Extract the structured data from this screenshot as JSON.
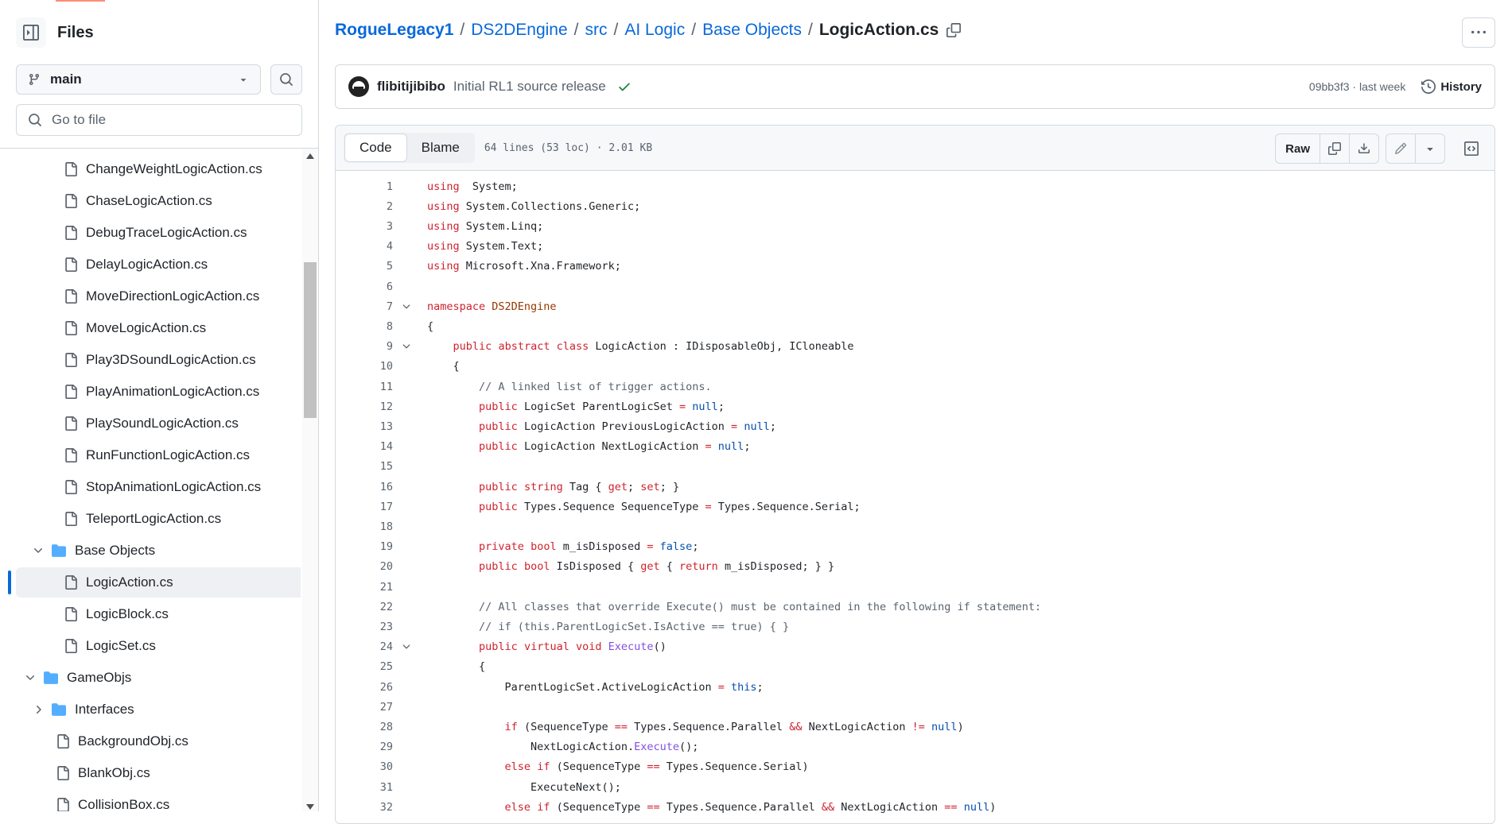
{
  "sidebar": {
    "title": "Files",
    "branch": "main",
    "goto_placeholder": "Go to file",
    "tree": [
      {
        "type": "file",
        "name": "ChangeWeightLogicAction.cs",
        "depth": 2
      },
      {
        "type": "file",
        "name": "ChaseLogicAction.cs",
        "depth": 2
      },
      {
        "type": "file",
        "name": "DebugTraceLogicAction.cs",
        "depth": 2
      },
      {
        "type": "file",
        "name": "DelayLogicAction.cs",
        "depth": 2
      },
      {
        "type": "file",
        "name": "MoveDirectionLogicAction.cs",
        "depth": 2
      },
      {
        "type": "file",
        "name": "MoveLogicAction.cs",
        "depth": 2
      },
      {
        "type": "file",
        "name": "Play3DSoundLogicAction.cs",
        "depth": 2
      },
      {
        "type": "file",
        "name": "PlayAnimationLogicAction.cs",
        "depth": 2
      },
      {
        "type": "file",
        "name": "PlaySoundLogicAction.cs",
        "depth": 2
      },
      {
        "type": "file",
        "name": "RunFunctionLogicAction.cs",
        "depth": 2
      },
      {
        "type": "file",
        "name": "StopAnimationLogicAction.cs",
        "depth": 2
      },
      {
        "type": "file",
        "name": "TeleportLogicAction.cs",
        "depth": 2
      },
      {
        "type": "folder",
        "name": "Base Objects",
        "depth": 1,
        "open": true
      },
      {
        "type": "file",
        "name": "LogicAction.cs",
        "depth": 2,
        "selected": true
      },
      {
        "type": "file",
        "name": "LogicBlock.cs",
        "depth": 2
      },
      {
        "type": "file",
        "name": "LogicSet.cs",
        "depth": 2
      },
      {
        "type": "folder",
        "name": "GameObjs",
        "depth": 0,
        "open": true
      },
      {
        "type": "folder",
        "name": "Interfaces",
        "depth": 1,
        "open": false
      },
      {
        "type": "file",
        "name": "BackgroundObj.cs",
        "depth": 1
      },
      {
        "type": "file",
        "name": "BlankObj.cs",
        "depth": 1
      },
      {
        "type": "file",
        "name": "CollisionBox.cs",
        "depth": 1
      }
    ]
  },
  "breadcrumb": {
    "repo": "RogueLegacy1",
    "parts": [
      "DS2DEngine",
      "src",
      "AI Logic",
      "Base Objects"
    ],
    "current": "LogicAction.cs"
  },
  "commit": {
    "author": "flibitijibibo",
    "message": "Initial RL1 source release",
    "meta": "09bb3f3 · last week",
    "history_label": "History"
  },
  "file": {
    "tabs": [
      "Code",
      "Blame"
    ],
    "active_tab": "Code",
    "info": "64 lines (53 loc) · 2.01 KB",
    "raw_label": "Raw"
  },
  "code_lines": [
    {
      "n": "1",
      "fold": false,
      "t": [
        [
          "kw",
          "using"
        ],
        [
          "",
          "  System;"
        ]
      ]
    },
    {
      "n": "2",
      "fold": false,
      "t": [
        [
          "kw",
          "using"
        ],
        [
          "",
          " System.Collections.Generic;"
        ]
      ]
    },
    {
      "n": "3",
      "fold": false,
      "t": [
        [
          "kw",
          "using"
        ],
        [
          "",
          " System.Linq;"
        ]
      ]
    },
    {
      "n": "4",
      "fold": false,
      "t": [
        [
          "kw",
          "using"
        ],
        [
          "",
          " System.Text;"
        ]
      ]
    },
    {
      "n": "5",
      "fold": false,
      "t": [
        [
          "kw",
          "using"
        ],
        [
          "",
          " Microsoft.Xna.Framework;"
        ]
      ]
    },
    {
      "n": "6",
      "fold": false,
      "t": []
    },
    {
      "n": "7",
      "fold": true,
      "t": [
        [
          "kw",
          "namespace"
        ],
        [
          "ent",
          " DS2DEngine"
        ]
      ]
    },
    {
      "n": "8",
      "fold": false,
      "t": [
        [
          "",
          "{"
        ]
      ]
    },
    {
      "n": "9",
      "fold": true,
      "t": [
        [
          "",
          "    "
        ],
        [
          "kw",
          "public"
        ],
        [
          "",
          " "
        ],
        [
          "kw",
          "abstract"
        ],
        [
          "",
          " "
        ],
        [
          "kw",
          "class"
        ],
        [
          "",
          " LogicAction : IDisposableObj, ICloneable"
        ]
      ]
    },
    {
      "n": "10",
      "fold": false,
      "t": [
        [
          "",
          "    {"
        ]
      ]
    },
    {
      "n": "11",
      "fold": false,
      "t": [
        [
          "",
          "        "
        ],
        [
          "cm",
          "// A linked list of trigger actions."
        ]
      ]
    },
    {
      "n": "12",
      "fold": false,
      "t": [
        [
          "",
          "        "
        ],
        [
          "kw",
          "public"
        ],
        [
          "",
          " LogicSet ParentLogicSet "
        ],
        [
          "kw",
          "="
        ],
        [
          "",
          " "
        ],
        [
          "c",
          "null"
        ],
        [
          "",
          ";"
        ]
      ]
    },
    {
      "n": "13",
      "fold": false,
      "t": [
        [
          "",
          "        "
        ],
        [
          "kw",
          "public"
        ],
        [
          "",
          " LogicAction PreviousLogicAction "
        ],
        [
          "kw",
          "="
        ],
        [
          "",
          " "
        ],
        [
          "c",
          "null"
        ],
        [
          "",
          ";"
        ]
      ]
    },
    {
      "n": "14",
      "fold": false,
      "t": [
        [
          "",
          "        "
        ],
        [
          "kw",
          "public"
        ],
        [
          "",
          " LogicAction NextLogicAction "
        ],
        [
          "kw",
          "="
        ],
        [
          "",
          " "
        ],
        [
          "c",
          "null"
        ],
        [
          "",
          ";"
        ]
      ]
    },
    {
      "n": "15",
      "fold": false,
      "t": []
    },
    {
      "n": "16",
      "fold": false,
      "t": [
        [
          "",
          "        "
        ],
        [
          "kw",
          "public"
        ],
        [
          "",
          " "
        ],
        [
          "kw",
          "string"
        ],
        [
          "",
          " Tag { "
        ],
        [
          "kw",
          "get"
        ],
        [
          "",
          "; "
        ],
        [
          "kw",
          "set"
        ],
        [
          "",
          "; }"
        ]
      ]
    },
    {
      "n": "17",
      "fold": false,
      "t": [
        [
          "",
          "        "
        ],
        [
          "kw",
          "public"
        ],
        [
          "",
          " Types.Sequence SequenceType "
        ],
        [
          "kw",
          "="
        ],
        [
          "",
          " Types.Sequence.Serial;"
        ]
      ]
    },
    {
      "n": "18",
      "fold": false,
      "t": []
    },
    {
      "n": "19",
      "fold": false,
      "t": [
        [
          "",
          "        "
        ],
        [
          "kw",
          "private"
        ],
        [
          "",
          " "
        ],
        [
          "kw",
          "bool"
        ],
        [
          "",
          " m_isDisposed "
        ],
        [
          "kw",
          "="
        ],
        [
          "",
          " "
        ],
        [
          "c",
          "false"
        ],
        [
          "",
          ";"
        ]
      ]
    },
    {
      "n": "20",
      "fold": false,
      "t": [
        [
          "",
          "        "
        ],
        [
          "kw",
          "public"
        ],
        [
          "",
          " "
        ],
        [
          "kw",
          "bool"
        ],
        [
          "",
          " IsDisposed { "
        ],
        [
          "kw",
          "get"
        ],
        [
          "",
          " { "
        ],
        [
          "kw",
          "return"
        ],
        [
          "",
          " m_isDisposed; } }"
        ]
      ]
    },
    {
      "n": "21",
      "fold": false,
      "t": []
    },
    {
      "n": "22",
      "fold": false,
      "t": [
        [
          "",
          "        "
        ],
        [
          "cm",
          "// All classes that override Execute() must be contained in the following if statement:"
        ]
      ]
    },
    {
      "n": "23",
      "fold": false,
      "t": [
        [
          "",
          "        "
        ],
        [
          "cm",
          "// if (this.ParentLogicSet.IsActive == true) { }"
        ]
      ]
    },
    {
      "n": "24",
      "fold": true,
      "t": [
        [
          "",
          "        "
        ],
        [
          "kw",
          "public"
        ],
        [
          "",
          " "
        ],
        [
          "kw",
          "virtual"
        ],
        [
          "",
          " "
        ],
        [
          "kw",
          "void"
        ],
        [
          "",
          " "
        ],
        [
          "fn",
          "Execute"
        ],
        [
          "",
          "()"
        ]
      ]
    },
    {
      "n": "25",
      "fold": false,
      "t": [
        [
          "",
          "        {"
        ]
      ]
    },
    {
      "n": "26",
      "fold": false,
      "t": [
        [
          "",
          "            ParentLogicSet.ActiveLogicAction "
        ],
        [
          "kw",
          "="
        ],
        [
          "",
          " "
        ],
        [
          "c",
          "this"
        ],
        [
          "",
          ";"
        ]
      ]
    },
    {
      "n": "27",
      "fold": false,
      "t": []
    },
    {
      "n": "28",
      "fold": false,
      "t": [
        [
          "",
          "            "
        ],
        [
          "kw",
          "if"
        ],
        [
          "",
          " (SequenceType "
        ],
        [
          "kw",
          "=="
        ],
        [
          "",
          " Types.Sequence.Parallel "
        ],
        [
          "kw",
          "&&"
        ],
        [
          "",
          " NextLogicAction "
        ],
        [
          "kw",
          "!="
        ],
        [
          "",
          " "
        ],
        [
          "c",
          "null"
        ],
        [
          "",
          ")"
        ]
      ]
    },
    {
      "n": "29",
      "fold": false,
      "t": [
        [
          "",
          "                NextLogicAction."
        ],
        [
          "fn",
          "Execute"
        ],
        [
          "",
          "();"
        ]
      ]
    },
    {
      "n": "30",
      "fold": false,
      "t": [
        [
          "",
          "            "
        ],
        [
          "kw",
          "else"
        ],
        [
          "",
          " "
        ],
        [
          "kw",
          "if"
        ],
        [
          "",
          " (SequenceType "
        ],
        [
          "kw",
          "=="
        ],
        [
          "",
          " Types.Sequence.Serial)"
        ]
      ]
    },
    {
      "n": "31",
      "fold": false,
      "t": [
        [
          "",
          "                ExecuteNext();"
        ]
      ]
    },
    {
      "n": "32",
      "fold": false,
      "t": [
        [
          "",
          "            "
        ],
        [
          "kw",
          "else"
        ],
        [
          "",
          " "
        ],
        [
          "kw",
          "if"
        ],
        [
          "",
          " (SequenceType "
        ],
        [
          "kw",
          "=="
        ],
        [
          "",
          " Types.Sequence.Parallel "
        ],
        [
          "kw",
          "&&"
        ],
        [
          "",
          " NextLogicAction "
        ],
        [
          "kw",
          "=="
        ],
        [
          "",
          " "
        ],
        [
          "c",
          "null"
        ],
        [
          "",
          ")"
        ]
      ]
    }
  ],
  "colors": {
    "link": "#0969da",
    "keyword": "#cf222e",
    "comment": "#59636e",
    "entity": "#953800",
    "function": "#8250df",
    "constant": "#0550ae",
    "folder": "#54aeff",
    "success": "#1a7f37"
  },
  "icons": {
    "sidebar_toggle": "sidebar-collapse-icon",
    "branch": "git-branch-icon",
    "search": "search-icon",
    "file": "file-icon",
    "folder": "folder-icon",
    "chevron": "chevron-icon",
    "copy": "copy-icon",
    "kebab": "kebab-horizontal-icon",
    "check": "check-icon",
    "history": "history-icon",
    "download": "download-icon",
    "pencil": "pencil-icon",
    "triangle_down": "triangle-down-icon",
    "symbols": "code-square-icon"
  }
}
